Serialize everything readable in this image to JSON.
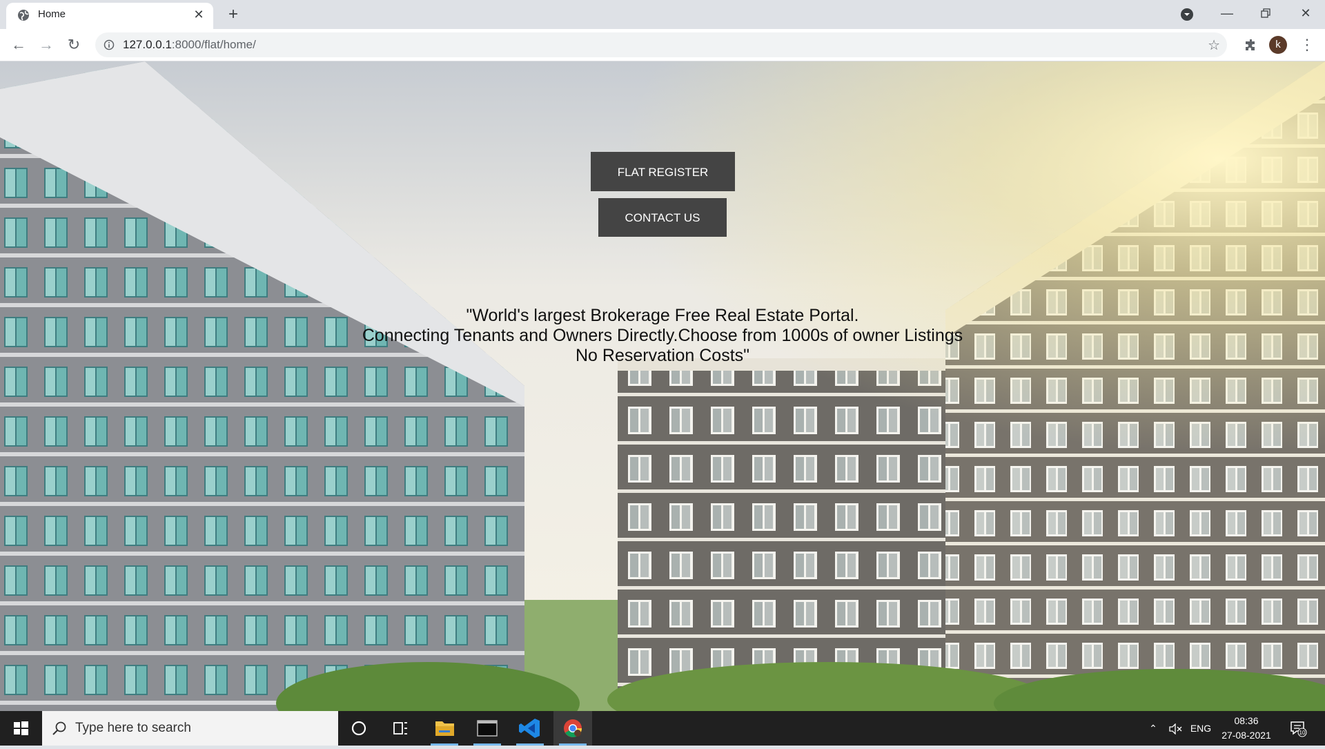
{
  "browser": {
    "tab_title": "Home",
    "url_host": "127.0.0.1",
    "url_rest": ":8000/flat/home/",
    "profile_initial": "k"
  },
  "page": {
    "buttons": {
      "flat_register": "FLAT REGISTER",
      "contact_us": "CONTACT US"
    },
    "tagline": {
      "line1": "\"World's largest Brokerage Free Real Estate Portal.",
      "line2": "Connecting Tenants and Owners Directly.Choose from 1000s of owner Listings",
      "line3": "No Reservation Costs\""
    },
    "button_color": "#444444"
  },
  "taskbar": {
    "search_placeholder": "Type here to search",
    "language": "ENG",
    "time": "08:36",
    "date": "27-08-2021",
    "notification_count": "10"
  }
}
